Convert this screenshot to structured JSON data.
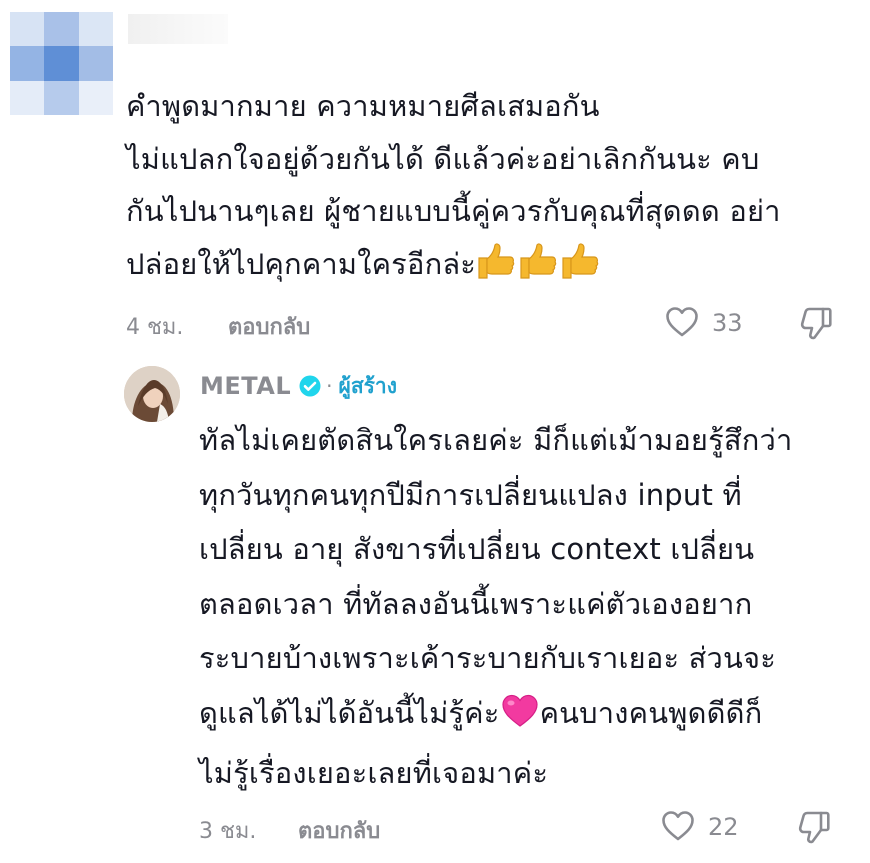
{
  "comment": {
    "text_lines": [
      "คำพูดมากมาย ความหมายศีลเสมอกัน",
      "ไม่แปลกใจอยู่ด้วยกันได้ ดีแล้วค่ะอย่าเลิกกันนะ คบ",
      "กันไปนานๆเลย ผู้ชายแบบนี้คู่ควรกับคุณที่สุดดด อย่า",
      "ปล่อยให้ไปคุกคามใครอีกล่ะ"
    ],
    "emoji": "thumbs-up-icon",
    "time": "4 ชม.",
    "reply_label": "ตอบกลับ",
    "like_count": "33"
  },
  "reply": {
    "author": "METAL",
    "separator": "·",
    "creator_label": "ผู้สร้าง",
    "text_lines": [
      "ทัลไม่เคยตัดสินใครเลยค่ะ มีก็แต่เม้ามอยรู้สึกว่า",
      "ทุกวันทุกคนทุกปีมีการเปลี่ยนแปลง input ที่",
      "เปลี่ยน อายุ สังขารที่เปลี่ยน context เปลี่ยน",
      "ตลอดเวลา ที่ทัลลงอันนี้เพราะแค่ตัวเองอยาก",
      "ระบายบ้างเพราะเค้าระบายกับเราเยอะ ส่วนจะ",
      "ดูแลได้ไม่ได้อันนี้ไม่รู้ค่ะ",
      "คนบางคนพูดดีดีก็",
      "ไม่รู้เรื่องเยอะเลยที่เจอมาค่ะ"
    ],
    "emoji": "pink-heart-icon",
    "time": "3 ชม.",
    "reply_label": "ตอบกลับ",
    "like_count": "22"
  },
  "colors": {
    "text": "#161823",
    "muted": "#8a8b91",
    "verified": "#20d5ec",
    "creator": "#20a1ce"
  }
}
